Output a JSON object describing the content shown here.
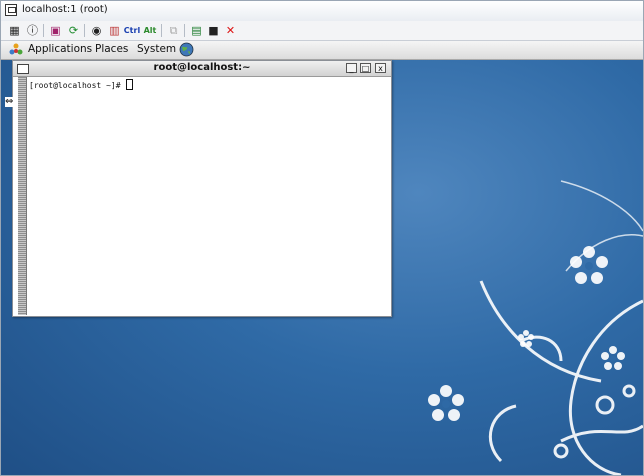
{
  "window": {
    "title": "localhost:1 (root)"
  },
  "toolbar": {
    "icons": [
      "options-icon",
      "info-icon",
      "fullscreen-icon",
      "refresh-icon",
      "view-icon",
      "ctrl-alt-del-icon"
    ],
    "ctrl_label": "Ctrl",
    "alt_label": "Alt"
  },
  "panel": {
    "applications": "Applications",
    "places": "Places",
    "system": "System"
  },
  "terminal": {
    "title": "root@localhost:~",
    "prompt": "[root@localhost ~]# ",
    "minimize": "_",
    "maximize": "□",
    "close": "x"
  },
  "colors": {
    "desktop": "#2f6aa6",
    "art": "#ffffff"
  }
}
